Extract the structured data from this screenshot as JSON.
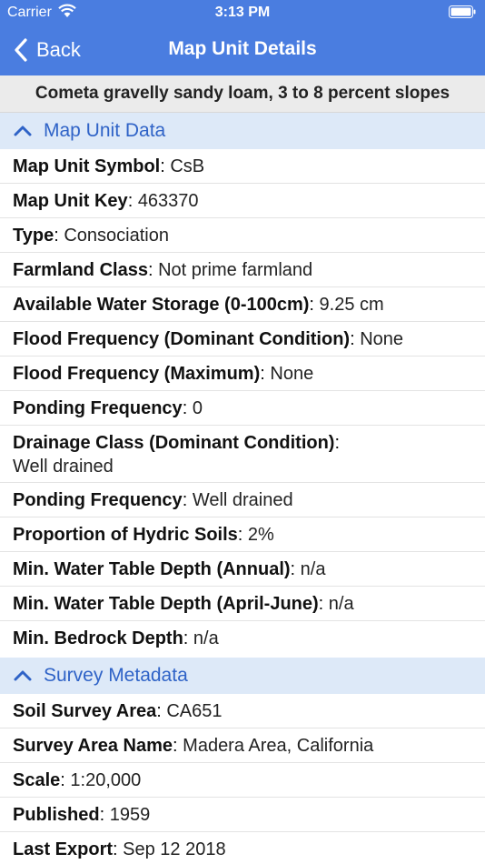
{
  "status_bar": {
    "carrier": "Carrier",
    "time": "3:13 PM"
  },
  "nav": {
    "back_label": "Back",
    "title": "Map Unit Details"
  },
  "map_unit_name": "Cometa gravelly sandy loam, 3 to 8 percent slopes",
  "sections": [
    {
      "title": "Map Unit Data",
      "rows": [
        {
          "label": "Map Unit Symbol",
          "value": "CsB"
        },
        {
          "label": "Map Unit Key",
          "value": "463370"
        },
        {
          "label": "Type",
          "value": "Consociation"
        },
        {
          "label": "Farmland Class",
          "value": "Not prime farmland"
        },
        {
          "label": "Available Water Storage (0-100cm)",
          "value": "9.25 cm"
        },
        {
          "label": "Flood Frequency (Dominant Condition)",
          "value": "None"
        },
        {
          "label": "Flood Frequency (Maximum)",
          "value": "None"
        },
        {
          "label": "Ponding Frequency",
          "value": "0"
        },
        {
          "label": "Drainage Class (Dominant Condition)",
          "value": "Well drained"
        },
        {
          "label": "Ponding Frequency",
          "value": "Well drained"
        },
        {
          "label": "Proportion of Hydric Soils",
          "value": "2%"
        },
        {
          "label": "Min. Water Table Depth (Annual)",
          "value": "n/a"
        },
        {
          "label": "Min. Water Table Depth (April-June)",
          "value": "n/a"
        },
        {
          "label": "Min. Bedrock Depth",
          "value": "n/a"
        }
      ]
    },
    {
      "title": "Survey Metadata",
      "rows": [
        {
          "label": "Soil Survey Area",
          "value": "CA651"
        },
        {
          "label": "Survey Area Name",
          "value": "Madera Area, California"
        },
        {
          "label": "Scale",
          "value": "1:20,000"
        },
        {
          "label": "Published",
          "value": "1959"
        },
        {
          "label": "Last Export",
          "value": "Sep 12 2018"
        }
      ]
    }
  ],
  "icons": {
    "back": "chevron-left-icon",
    "section_toggle": "chevron-up-icon",
    "wifi": "wifi-icon",
    "battery": "battery-icon"
  },
  "colors": {
    "nav_background": "#4a7de0",
    "section_background": "#dde9f8",
    "section_text": "#2f63c7"
  }
}
